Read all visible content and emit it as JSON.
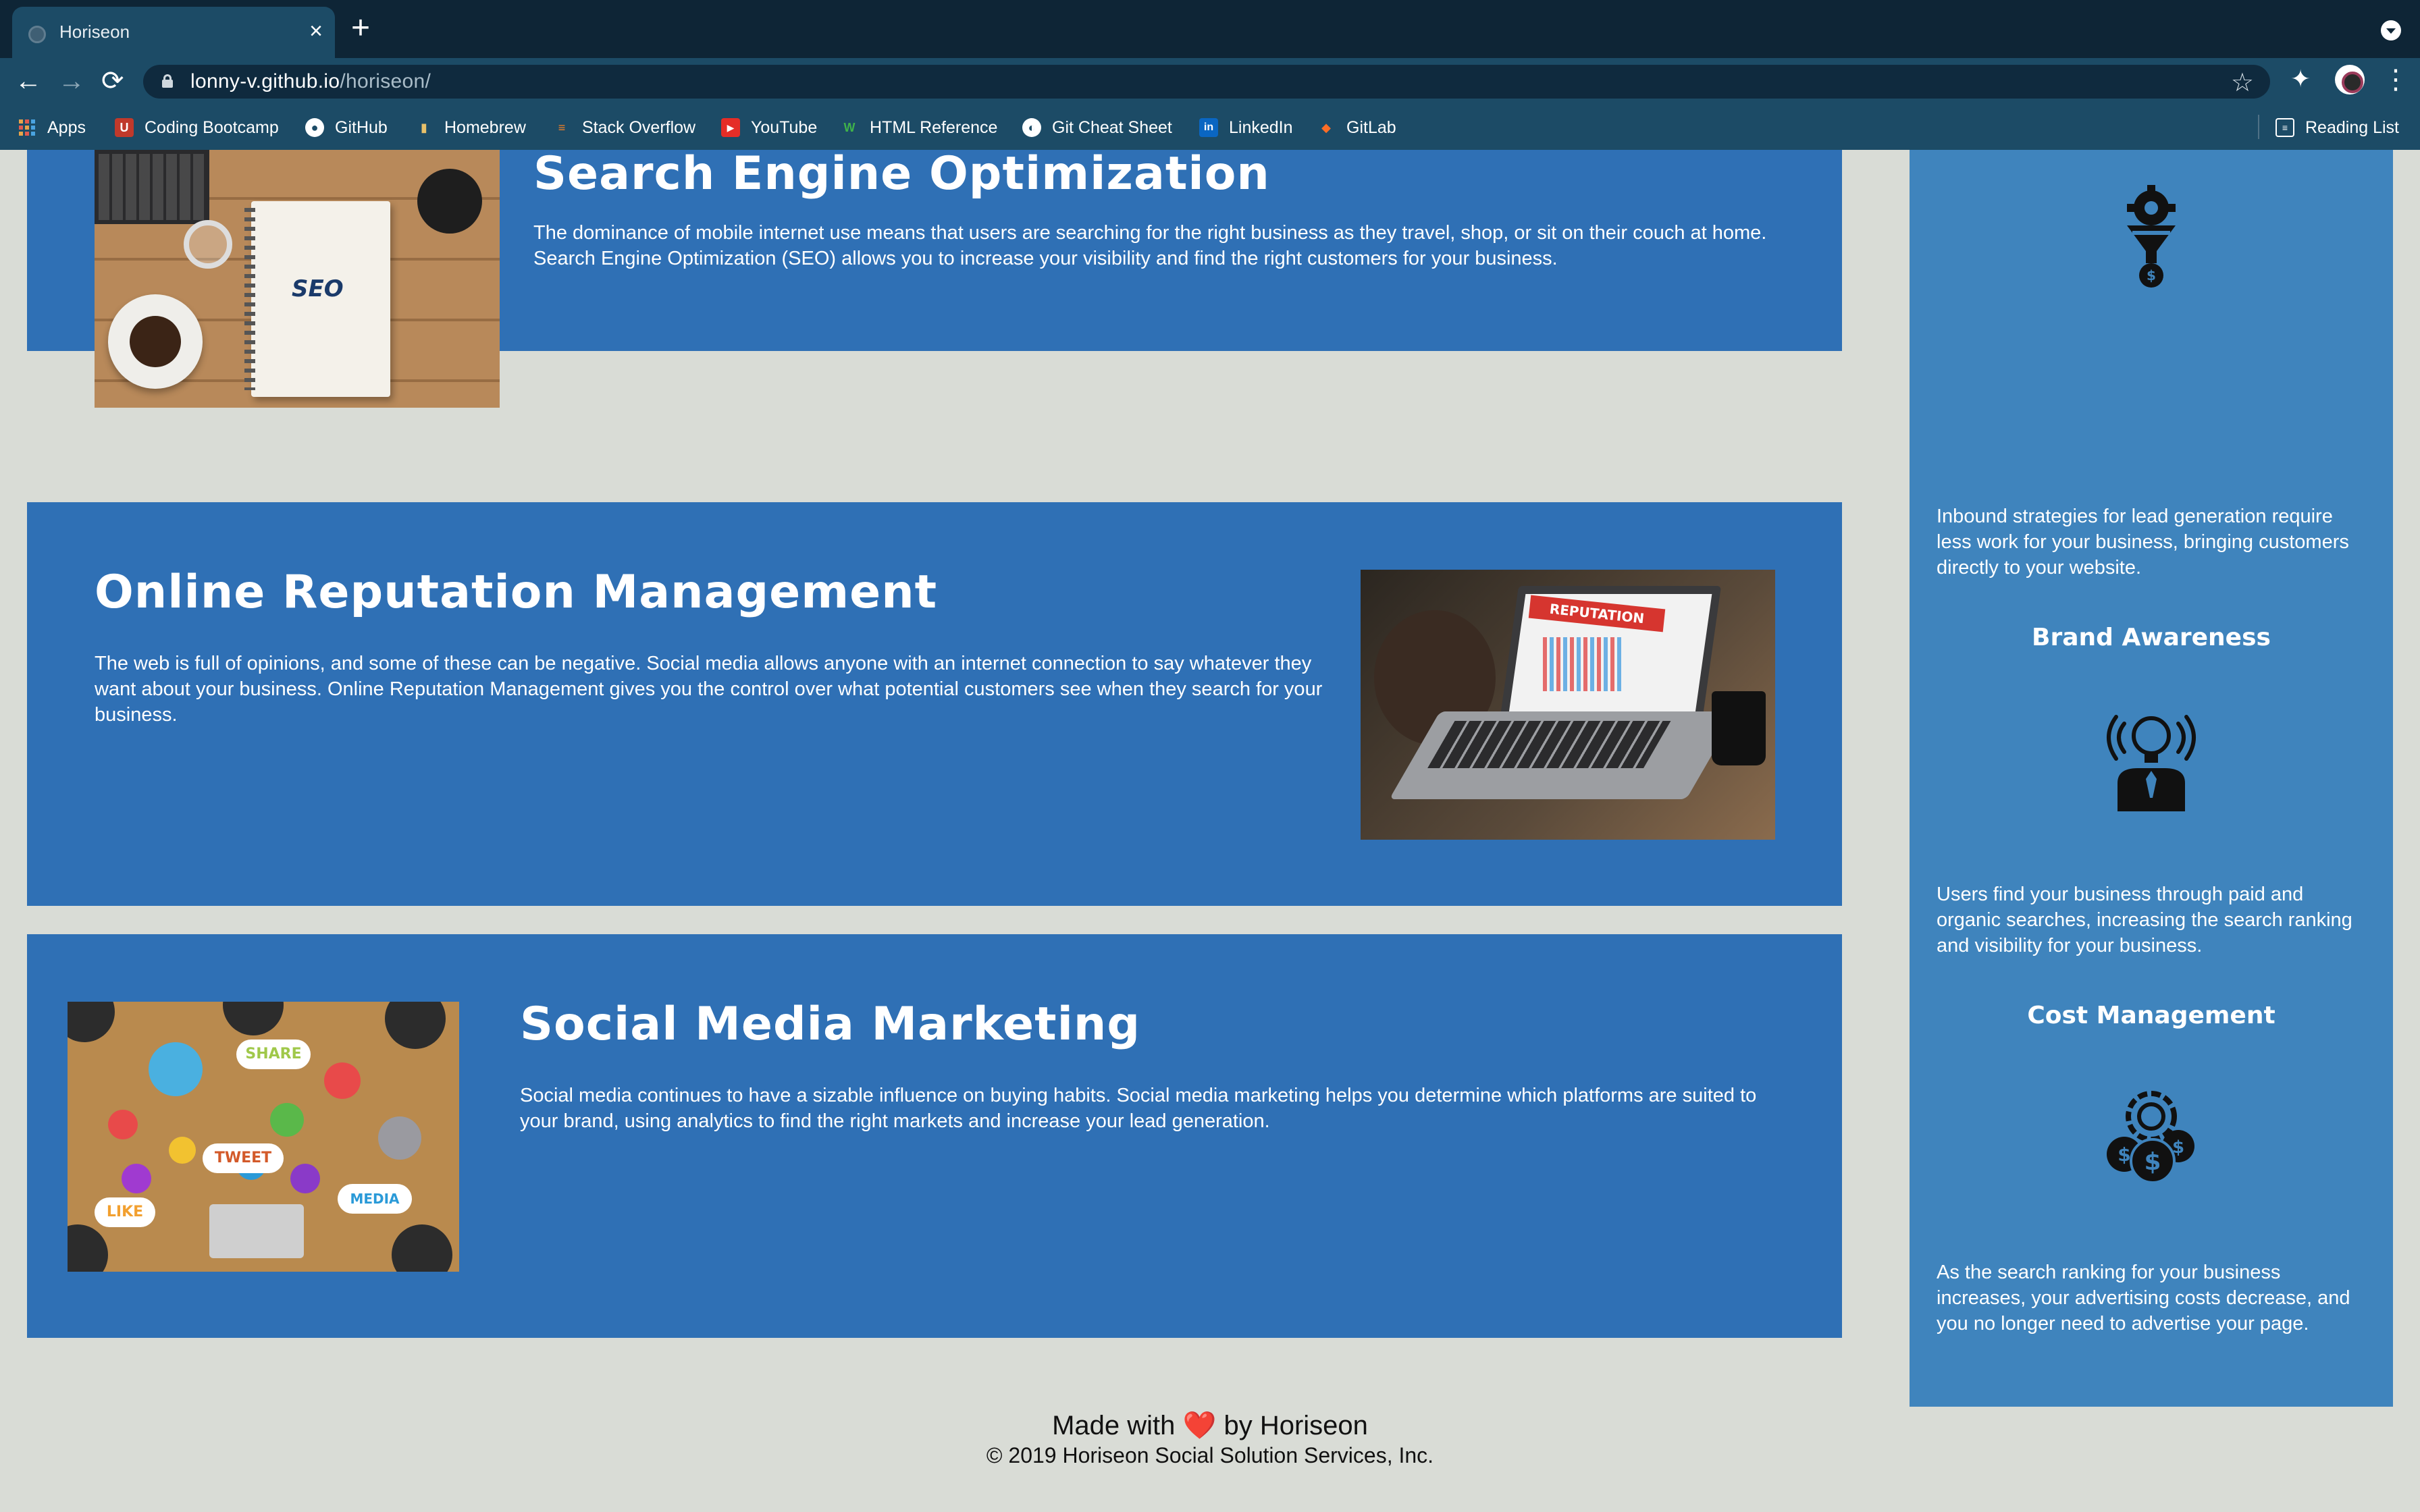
{
  "browser": {
    "tab_title": "Horiseon",
    "new_tab": "+",
    "close_tab": "×",
    "url_host": "lonny-v.github.io",
    "url_path": "/horiseon/",
    "back": "←",
    "forward": "→",
    "reload": "⟳",
    "bookmark_star": "☆",
    "extensions": "✦",
    "menu": "⋮",
    "bookmarks": [
      {
        "label": "Apps",
        "icon": "apps-grid-icon"
      },
      {
        "label": "Coding Bootcamp",
        "icon": "bootcamp-icon"
      },
      {
        "label": "GitHub",
        "icon": "github-icon"
      },
      {
        "label": "Homebrew",
        "icon": "homebrew-icon"
      },
      {
        "label": "Stack Overflow",
        "icon": "stackoverflow-icon"
      },
      {
        "label": "YouTube",
        "icon": "youtube-icon"
      },
      {
        "label": "HTML Reference",
        "icon": "html-reference-icon"
      },
      {
        "label": "Git Cheat Sheet",
        "icon": "git-cheat-sheet-icon"
      },
      {
        "label": "LinkedIn",
        "icon": "linkedin-icon"
      },
      {
        "label": "GitLab",
        "icon": "gitlab-icon"
      }
    ],
    "reading_list": "Reading List"
  },
  "content": {
    "seo": {
      "title": "Search Engine Optimization",
      "text": "The dominance of mobile internet use means that users are searching for the right business as they travel, shop, or sit on their couch at home. Search Engine Optimization (SEO) allows you to increase your visibility and find the right customers for your business.",
      "image_label": "SEO"
    },
    "orm": {
      "title": "Online Reputation Management",
      "text": "The web is full of opinions, and some of these can be negative. Social media allows anyone with an internet connection to say whatever they want about your business. Online Reputation Management gives you the control over what potential customers see when they search for your business.",
      "image_label": "REPUTATION"
    },
    "smm": {
      "title": "Social Media Marketing",
      "text": "Social media continues to have a sizable influence on buying habits. Social media marketing helps you determine which platforms are suited to your brand, using analytics to find the right markets and increase your lead generation.",
      "image_labels": [
        "SHARE",
        "TWEET",
        "LIKE",
        "MEDIA"
      ]
    }
  },
  "sidebar": {
    "lead_generation_text": "Inbound strategies for lead generation require less work for your business, bringing customers directly to your website.",
    "brand_awareness_title": "Brand Awareness",
    "brand_awareness_text": "Users find your business through paid and organic searches, increasing the search ranking and visibility for your business.",
    "cost_management_title": "Cost Management",
    "cost_management_text": "As the search ranking for your business increases, your advertising costs decrease, and you no longer need to advertise your page."
  },
  "footer": {
    "made_with": "Made with",
    "heart": "❤️",
    "by": "by Horiseon",
    "copyright": "© 2019 Horiseon Social Solution Services, Inc."
  },
  "colors": {
    "chrome_dark": "#0e2536",
    "chrome_toolbar": "#1c4b66",
    "card_blue": "#2f70b5",
    "sidebar_blue": "#3f84bd",
    "page_bg": "#d9dcd6"
  }
}
